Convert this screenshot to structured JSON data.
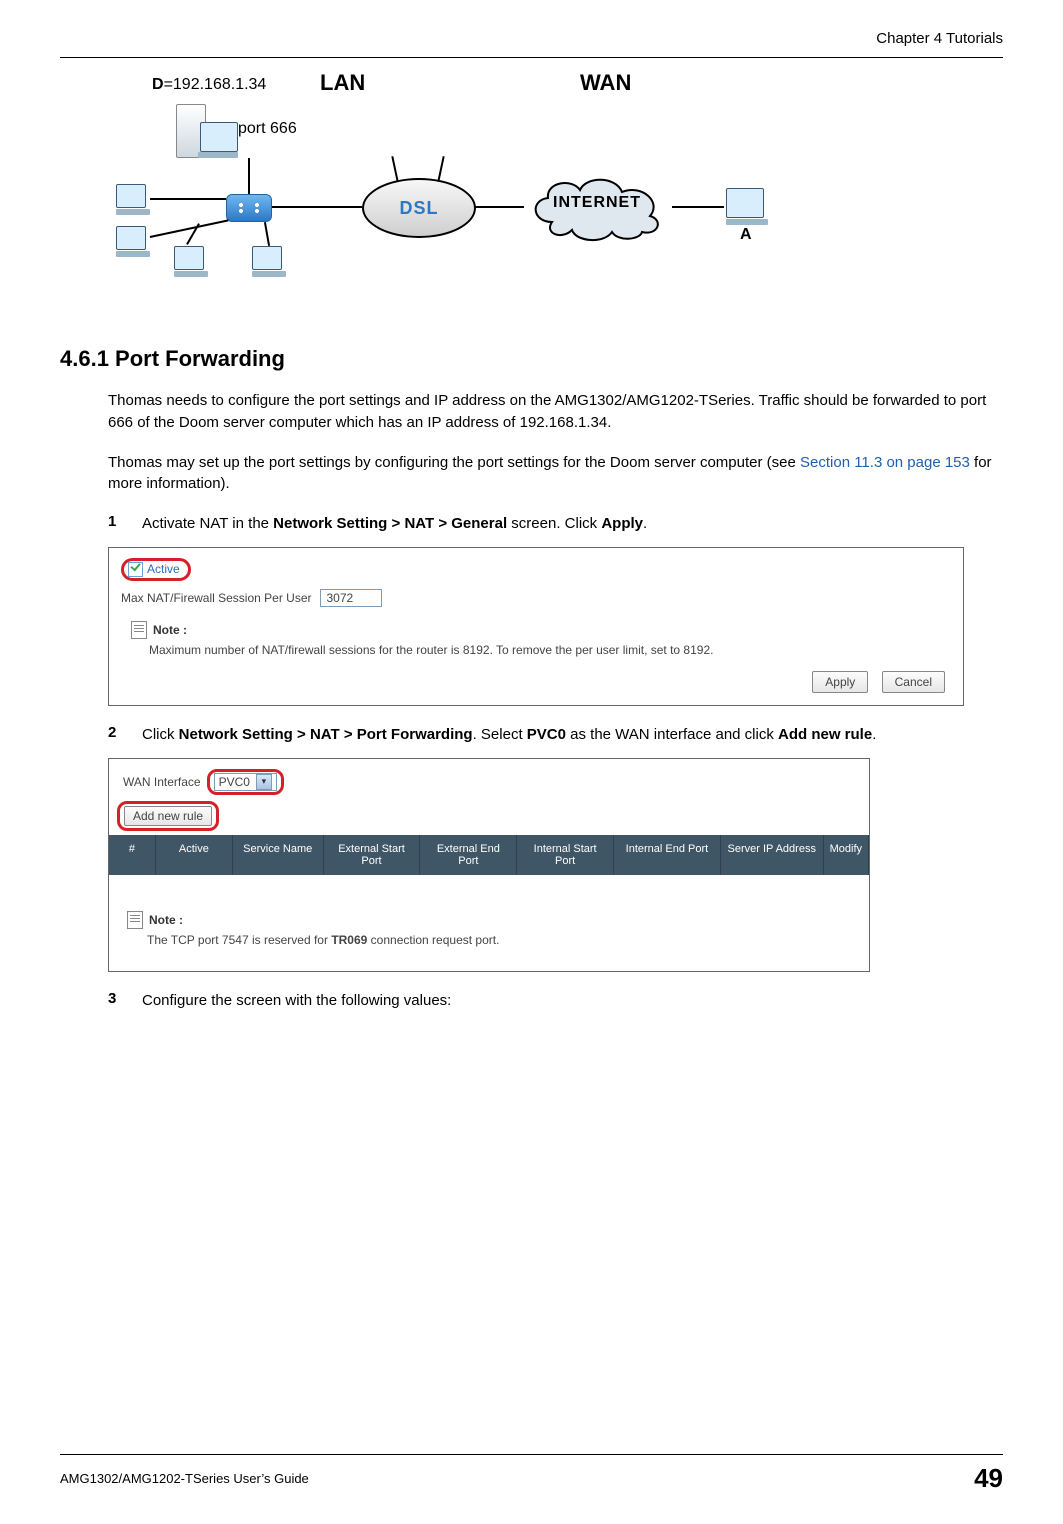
{
  "header": {
    "chapter": "Chapter 4 Tutorials"
  },
  "diagram": {
    "d_label_prefix": "D",
    "d_ip": "=192.168.1.34",
    "lan": "LAN",
    "wan": "WAN",
    "port": "port 666",
    "router_text": "DSL",
    "cloud_text": "INTERNET",
    "a_label": "A"
  },
  "section": {
    "number_title": "4.6.1  Port Forwarding"
  },
  "paras": {
    "p1": "Thomas needs to configure the port settings and IP address on the AMG1302/AMG1202-TSeries. Traffic should be forwarded to port 666 of the Doom server computer which has an IP address of 192.168.1.34.",
    "p2_a": "Thomas may set up the port settings by configuring the port settings for the Doom server computer (see ",
    "p2_link": "Section 11.3 on page 153",
    "p2_b": " for more information)."
  },
  "steps": {
    "s1_num": "1",
    "s1_a": "Activate NAT in the ",
    "s1_bold": "Network Setting > NAT > General",
    "s1_b": " screen. Click ",
    "s1_bold2": "Apply",
    "s1_c": ".",
    "s2_num": "2",
    "s2_a": "Click ",
    "s2_bold": "Network Setting > NAT > Port Forwarding",
    "s2_b": ". Select ",
    "s2_bold2": "PVC0",
    "s2_c": " as the WAN interface and click ",
    "s2_bold3": "Add new rule",
    "s2_d": ".",
    "s3_num": "3",
    "s3_txt": "Configure the screen with the following values:"
  },
  "panel1": {
    "active_label": "Active",
    "max_label": "Max NAT/Firewall Session Per User",
    "max_value": "3072",
    "note_label": "Note :",
    "note_text": "Maximum number of NAT/firewall sessions for the router is 8192. To remove the per user limit, set to 8192.",
    "apply": "Apply",
    "cancel": "Cancel"
  },
  "panel2": {
    "wan_label": "WAN Interface",
    "wan_value": "PVC0",
    "add_rule": "Add new rule",
    "th_num": "#",
    "th_active": "Active",
    "th_service": "Service Name",
    "th_ext_start": "External Start Port",
    "th_ext_end": "External End Port",
    "th_int_start": "Internal Start Port",
    "th_int_end": "Internal End Port",
    "th_ip": "Server IP Address",
    "th_modify": "Modify",
    "note_label": "Note :",
    "note_text_a": "The TCP port  7547 is reserved for ",
    "note_text_bold": "TR069",
    "note_text_b": " connection request port."
  },
  "footer": {
    "guide": "AMG1302/AMG1202-TSeries User’s Guide",
    "page": "49"
  }
}
